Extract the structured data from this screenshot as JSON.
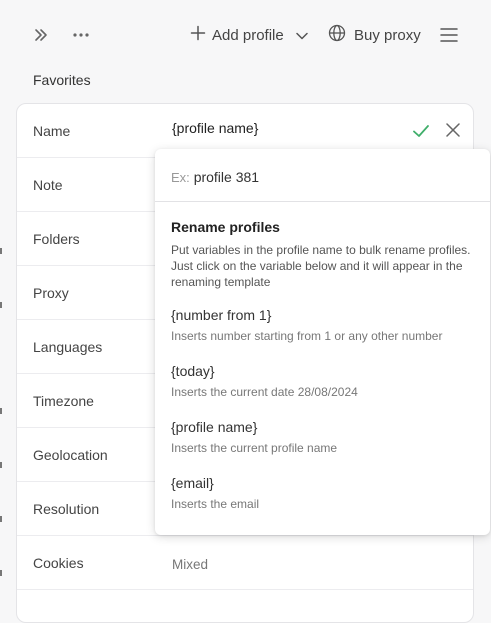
{
  "toolbar": {
    "add_profile_label": "Add profile",
    "buy_proxy_label": "Buy proxy"
  },
  "section": {
    "title": "Favorites"
  },
  "form": {
    "name": {
      "label": "Name",
      "value": "{profile name}"
    },
    "rows": [
      {
        "label": "Note",
        "value": ""
      },
      {
        "label": "Folders",
        "value": ""
      },
      {
        "label": "Proxy",
        "value": ""
      },
      {
        "label": "Languages",
        "value": ""
      },
      {
        "label": "Timezone",
        "value": ""
      },
      {
        "label": "Geolocation",
        "value": ""
      },
      {
        "label": "Resolution",
        "value": ""
      },
      {
        "label": "Cookies",
        "value": "Mixed"
      }
    ]
  },
  "popup": {
    "example_prefix": "Ex:",
    "example_value": "profile 381",
    "heading": "Rename profiles",
    "description": "Put variables in the profile name to bulk rename profiles. Just click on the variable below and it will appear in the renaming template",
    "variables": [
      {
        "token": "{number from 1}",
        "hint": "Inserts number starting from 1 or any other number"
      },
      {
        "token": "{today}",
        "hint": "Inserts the current date 28/08/2024"
      },
      {
        "token": "{profile name}",
        "hint": "Inserts the current profile name"
      },
      {
        "token": "{email}",
        "hint": "Inserts the email"
      }
    ]
  },
  "colors": {
    "check": "#3fae6a",
    "icon": "#666666",
    "background": "#f7f7f8"
  }
}
